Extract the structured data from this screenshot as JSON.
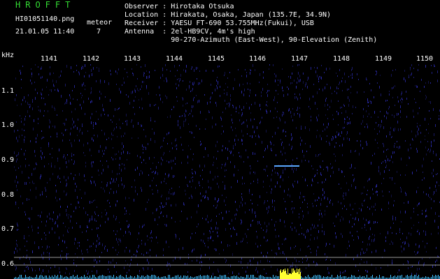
{
  "header": {
    "title": "HROFFT",
    "filename": "HI01051140.png",
    "meteor_label": "meteor",
    "datetime": "21.01.05 11:40",
    "meteor_count": "7"
  },
  "info": {
    "observer": "Observer : Hirotaka Otsuka",
    "location": "Location : Hirakata, Osaka, Japan (135.7E, 34.9N)",
    "receiver": "Receiver : YAESU FT-690 53.755MHz(Fukui), USB",
    "antenna": "Antenna  : 2el-HB9CV, 4m's high",
    "antenna2": "           90-270-Azimuth (East-West), 90-Elevation (Zenith)"
  },
  "axes": {
    "unit": "kHz",
    "freq_labels": [
      "1141",
      "1142",
      "1143",
      "1144",
      "1145",
      "1146",
      "1147",
      "1148",
      "1149",
      "1150"
    ],
    "y_labels": [
      "1.1",
      "1.0",
      "0.9",
      "0.8",
      "0.7",
      "0.6"
    ]
  },
  "colors": {
    "background": "#000000",
    "noise": "#1a1a88",
    "title": "#33dd33",
    "trace": "#5aa8ff",
    "baseline": "#40c0ff",
    "burst": "#ffff33"
  }
}
